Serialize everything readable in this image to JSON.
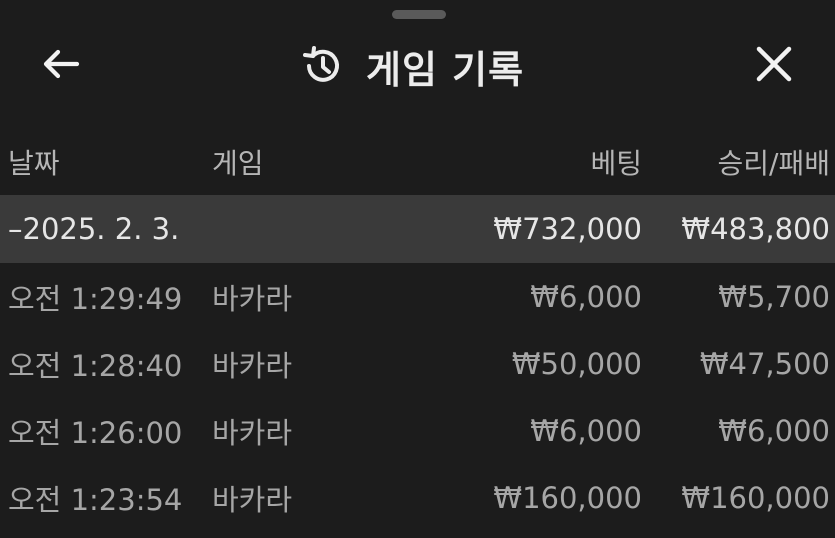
{
  "header": {
    "title": "게임 기록",
    "back_icon": "arrow-left-icon",
    "history_icon": "history-icon",
    "close_icon": "close-icon"
  },
  "table": {
    "columns": [
      "날짜",
      "게임",
      "베팅",
      "승리/패배"
    ],
    "group": {
      "date": "–2025. 2. 3.",
      "bet": "₩732,000",
      "result": "₩483,800"
    },
    "rows": [
      {
        "time": "오전 1:29:49",
        "game": "바카라",
        "bet": "₩6,000",
        "result": "₩5,700"
      },
      {
        "time": "오전 1:28:40",
        "game": "바카라",
        "bet": "₩50,000",
        "result": "₩47,500"
      },
      {
        "time": "오전 1:26:00",
        "game": "바카라",
        "bet": "₩6,000",
        "result": "₩6,000"
      },
      {
        "time": "오전 1:23:54",
        "game": "바카라",
        "bet": "₩160,000",
        "result": "₩160,000"
      }
    ]
  },
  "colors": {
    "background": "#1c1c1c",
    "group_row": "#3a3a3a",
    "title": "#ececec",
    "text": "#a6a6a6"
  }
}
